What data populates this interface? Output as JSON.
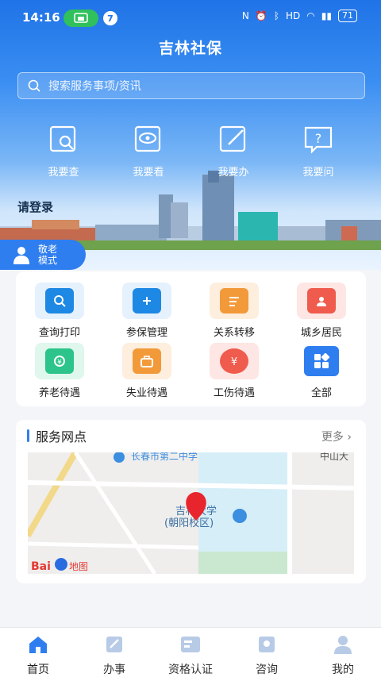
{
  "status_bar": {
    "time": "14:16",
    "notification_count": "7",
    "battery": "71"
  },
  "header": {
    "title": "吉林社保"
  },
  "search": {
    "placeholder": "搜索服务事项/资讯"
  },
  "quick_actions": [
    {
      "label": "我要查",
      "icon": "search-doc-icon"
    },
    {
      "label": "我要看",
      "icon": "eye-doc-icon"
    },
    {
      "label": "我要办",
      "icon": "edit-doc-icon"
    },
    {
      "label": "我要问",
      "icon": "question-chat-icon"
    }
  ],
  "login_prompt": "请登录",
  "elder_mode": {
    "line1": "敬老",
    "line2": "模式"
  },
  "services": [
    {
      "label": "查询打印",
      "icon": "search-print-icon",
      "color": "#1e88e5",
      "bg": "#e5f1fd"
    },
    {
      "label": "参保管理",
      "icon": "shield-plus-icon",
      "color": "#1e88e5",
      "bg": "#e5f1fd"
    },
    {
      "label": "关系转移",
      "icon": "transfer-doc-icon",
      "color": "#f29a3a",
      "bg": "#fdeedd"
    },
    {
      "label": "城乡居民",
      "icon": "resident-doc-icon",
      "color": "#ef5b4c",
      "bg": "#fde6e3"
    },
    {
      "label": "养老待遇",
      "icon": "pension-icon",
      "color": "#2cc48a",
      "bg": "#dff7ec"
    },
    {
      "label": "失业待遇",
      "icon": "unemployment-bag-icon",
      "color": "#f29a3a",
      "bg": "#fdeedd"
    },
    {
      "label": "工伤待遇",
      "icon": "injury-yuan-icon",
      "color": "#ef5b4c",
      "bg": "#fde6e3"
    },
    {
      "label": "全部",
      "icon": "all-grid-icon",
      "color": "#2f7ef0",
      "bg": "#ffffff"
    }
  ],
  "service_points": {
    "title": "服务网点",
    "more": "更多",
    "map_labels": {
      "university": "吉林大学",
      "campus": "(朝阳校区)",
      "road": "中山大",
      "top_place": "长春市第二中学",
      "provider": "地图"
    }
  },
  "tabs": [
    {
      "label": "首页",
      "icon": "home-icon",
      "active": true
    },
    {
      "label": "办事",
      "icon": "pencil-task-icon",
      "active": false
    },
    {
      "label": "资格认证",
      "icon": "certificate-icon",
      "active": false
    },
    {
      "label": "咨询",
      "icon": "consult-book-icon",
      "active": false
    },
    {
      "label": "我的",
      "icon": "profile-icon",
      "active": false
    }
  ]
}
